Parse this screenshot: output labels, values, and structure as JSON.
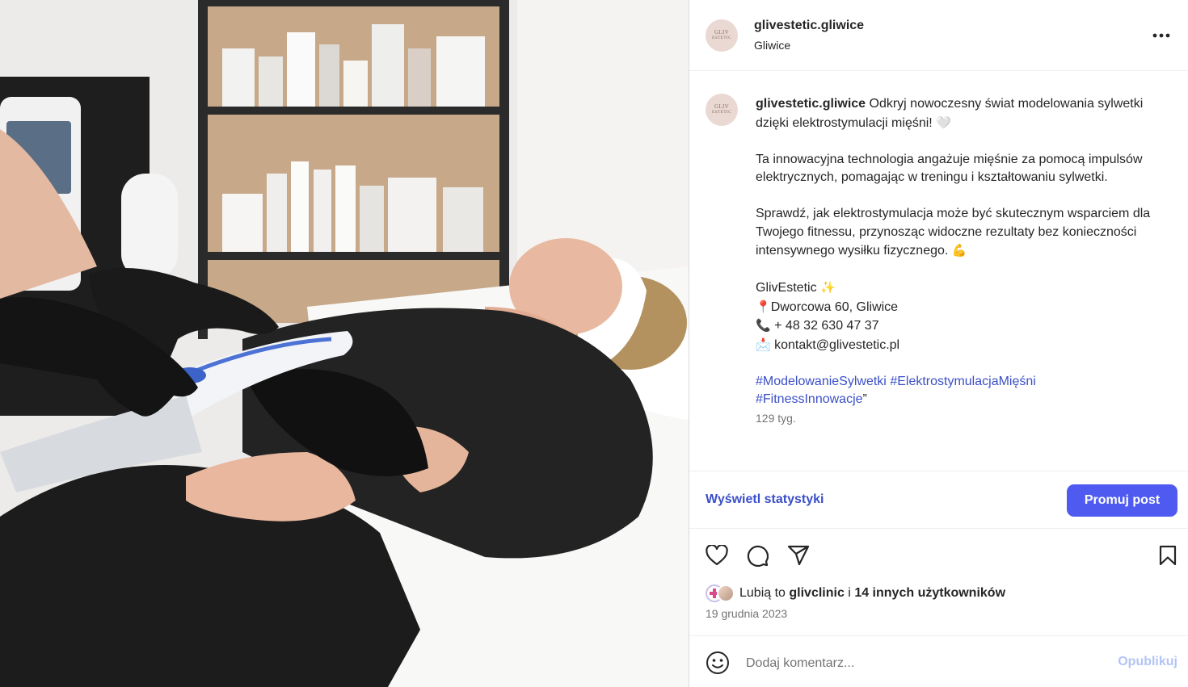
{
  "post": {
    "username": "glivestetic.gliwice",
    "location": "Gliwice",
    "avatar_logo_top": "GLIV",
    "avatar_logo_bottom": "ESTETIC"
  },
  "caption": {
    "username": "glivestetic.gliwice",
    "line1": " Odkryj nowoczesny świat modelowania sylwetki dzięki elektrostymulacji mięśni! ",
    "line1_emoji": "🤍",
    "para2": "Ta innowacyjna technologia angażuje mięśnie za pomocą impulsów elektrycznych, pomagając w treningu i kształtowaniu sylwetki.",
    "para3": "Sprawdź, jak elektrostymulacja może być skutecznym wsparciem dla Twojego fitnessu, przynosząc widoczne rezultaty bez konieczności intensywnego wysiłku fizycznego. ",
    "para3_emoji": "💪",
    "brand": "GlivEstetic ",
    "brand_emoji": "✨",
    "address_emoji": "📍",
    "address": "Dworcowa 60, Gliwice",
    "phone_emoji": "📞",
    "phone": " + 48 32 630 47 37",
    "email_emoji": "📩",
    "email": " kontakt@glivestetic.pl",
    "hashtags": [
      "#ModelowanieSylwetki",
      "#ElektrostymulacjaMięśni",
      "#FitnessInnowacje"
    ],
    "hashtag_suffix": "”",
    "age": "129 tyg."
  },
  "stats": {
    "view_stats_label": "Wyświetl statystyki",
    "promote_label": "Promuj post"
  },
  "icons": {
    "like": "heart-icon",
    "comment": "comment-icon",
    "share": "send-icon",
    "save": "bookmark-icon",
    "more": "more-horizontal-icon",
    "emoji": "emoji-icon"
  },
  "likes": {
    "prefix": "Lubią to ",
    "user": "glivclinic",
    "middle": " i ",
    "others": "14 innych użytkowników"
  },
  "date": "19 grudnia 2023",
  "comment": {
    "placeholder": "Dodaj komentarz...",
    "publish_label": "Opublikuj"
  },
  "colors": {
    "link": "#3b4fc7",
    "promote_button": "#4f5bf0",
    "publish_disabled": "#b2c4f7",
    "muted_text": "#737373"
  }
}
